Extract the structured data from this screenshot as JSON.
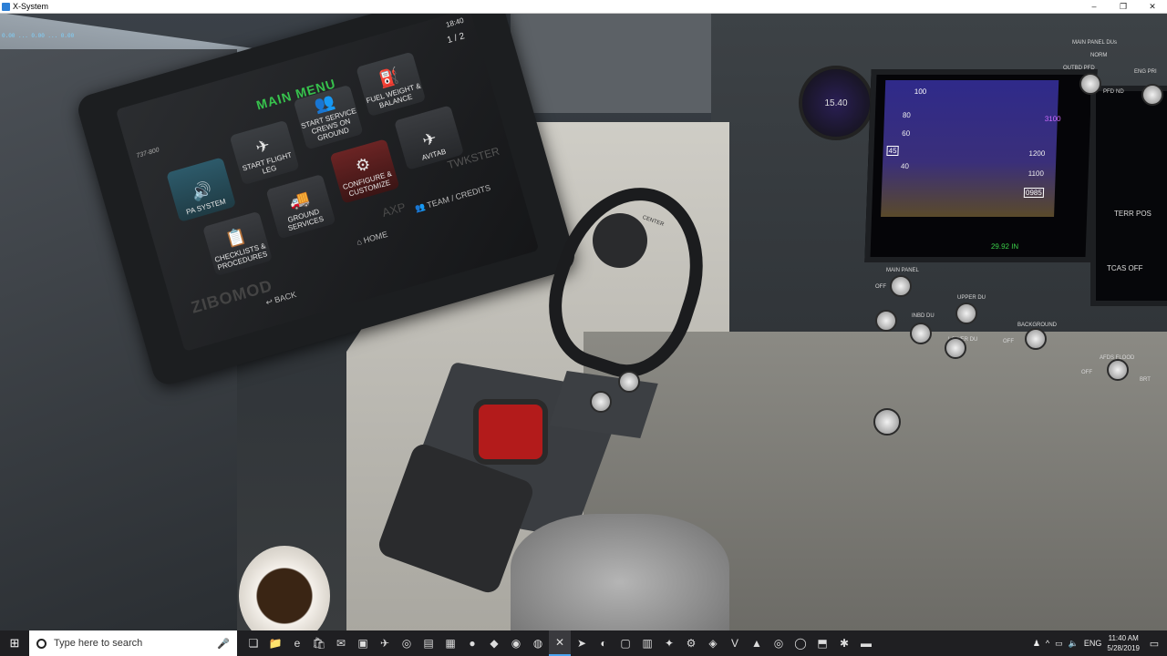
{
  "window": {
    "title": "X-System",
    "min": "–",
    "restore": "❐",
    "close": "✕"
  },
  "hud": "0.00 ... 0.00 ... 0.00",
  "tablet": {
    "time": "18:40",
    "page": "1 / 2",
    "model": "737-800",
    "menu_title": "MAIN MENU",
    "tiles": {
      "pa_system": "PA SYSTEM",
      "start_flight_leg": "START FLIGHT LEG",
      "start_service_crews": "START SERVICE CREWS ON GROUND",
      "fuel_weight_balance": "FUEL WEIGHT & BALANCE",
      "checklists": "CHECKLISTS & PROCEDURES",
      "ground_services": "GROUND SERVICES",
      "configure": "CONFIGURE & CUSTOMIZE",
      "avitab": "AVITAB"
    },
    "brand_zibo": "ZIBOMOD",
    "brand_twk": "TWKSTER",
    "brand_axp": "AXP",
    "home": "HOME",
    "team_credits": "TEAM / CREDITS",
    "back": "BACK"
  },
  "yoke_label": "CENTER",
  "instruments": {
    "standby_alt": "15.40",
    "pfd_speed_top": "100",
    "pfd_alt_top": "3100",
    "pfd_alt_box": "0985",
    "pfd_baro": "29.92 IN",
    "pfd_mark_1200": "1200",
    "pfd_mark_1100": "1100",
    "pfd_speed_80": "80",
    "pfd_speed_60": "60",
    "pfd_speed_40": "40",
    "pfd_speed_box": "45",
    "nd_text_1": "TERR POS",
    "nd_text_2": "TCAS OFF",
    "main_panel_du": "MAIN PANEL DUs",
    "norm": "NORM",
    "outbd_pfd": "OUTBD PFD",
    "eng_pri": "ENG PRI",
    "pfd": "PFD",
    "nd": "ND",
    "main_panel": "MAIN PANEL",
    "upper_du": "UPPER DU",
    "inbd_du": "INBD DU",
    "lower_du": "LOWER DU",
    "background": "BACKGROUND",
    "afds_flood": "AFDS FLOOD",
    "off": "OFF",
    "brt": "BRT"
  },
  "taskbar": {
    "search_placeholder": "Type here to search",
    "lang": "ENG",
    "time": "11:40 AM",
    "date": "5/28/2019"
  }
}
